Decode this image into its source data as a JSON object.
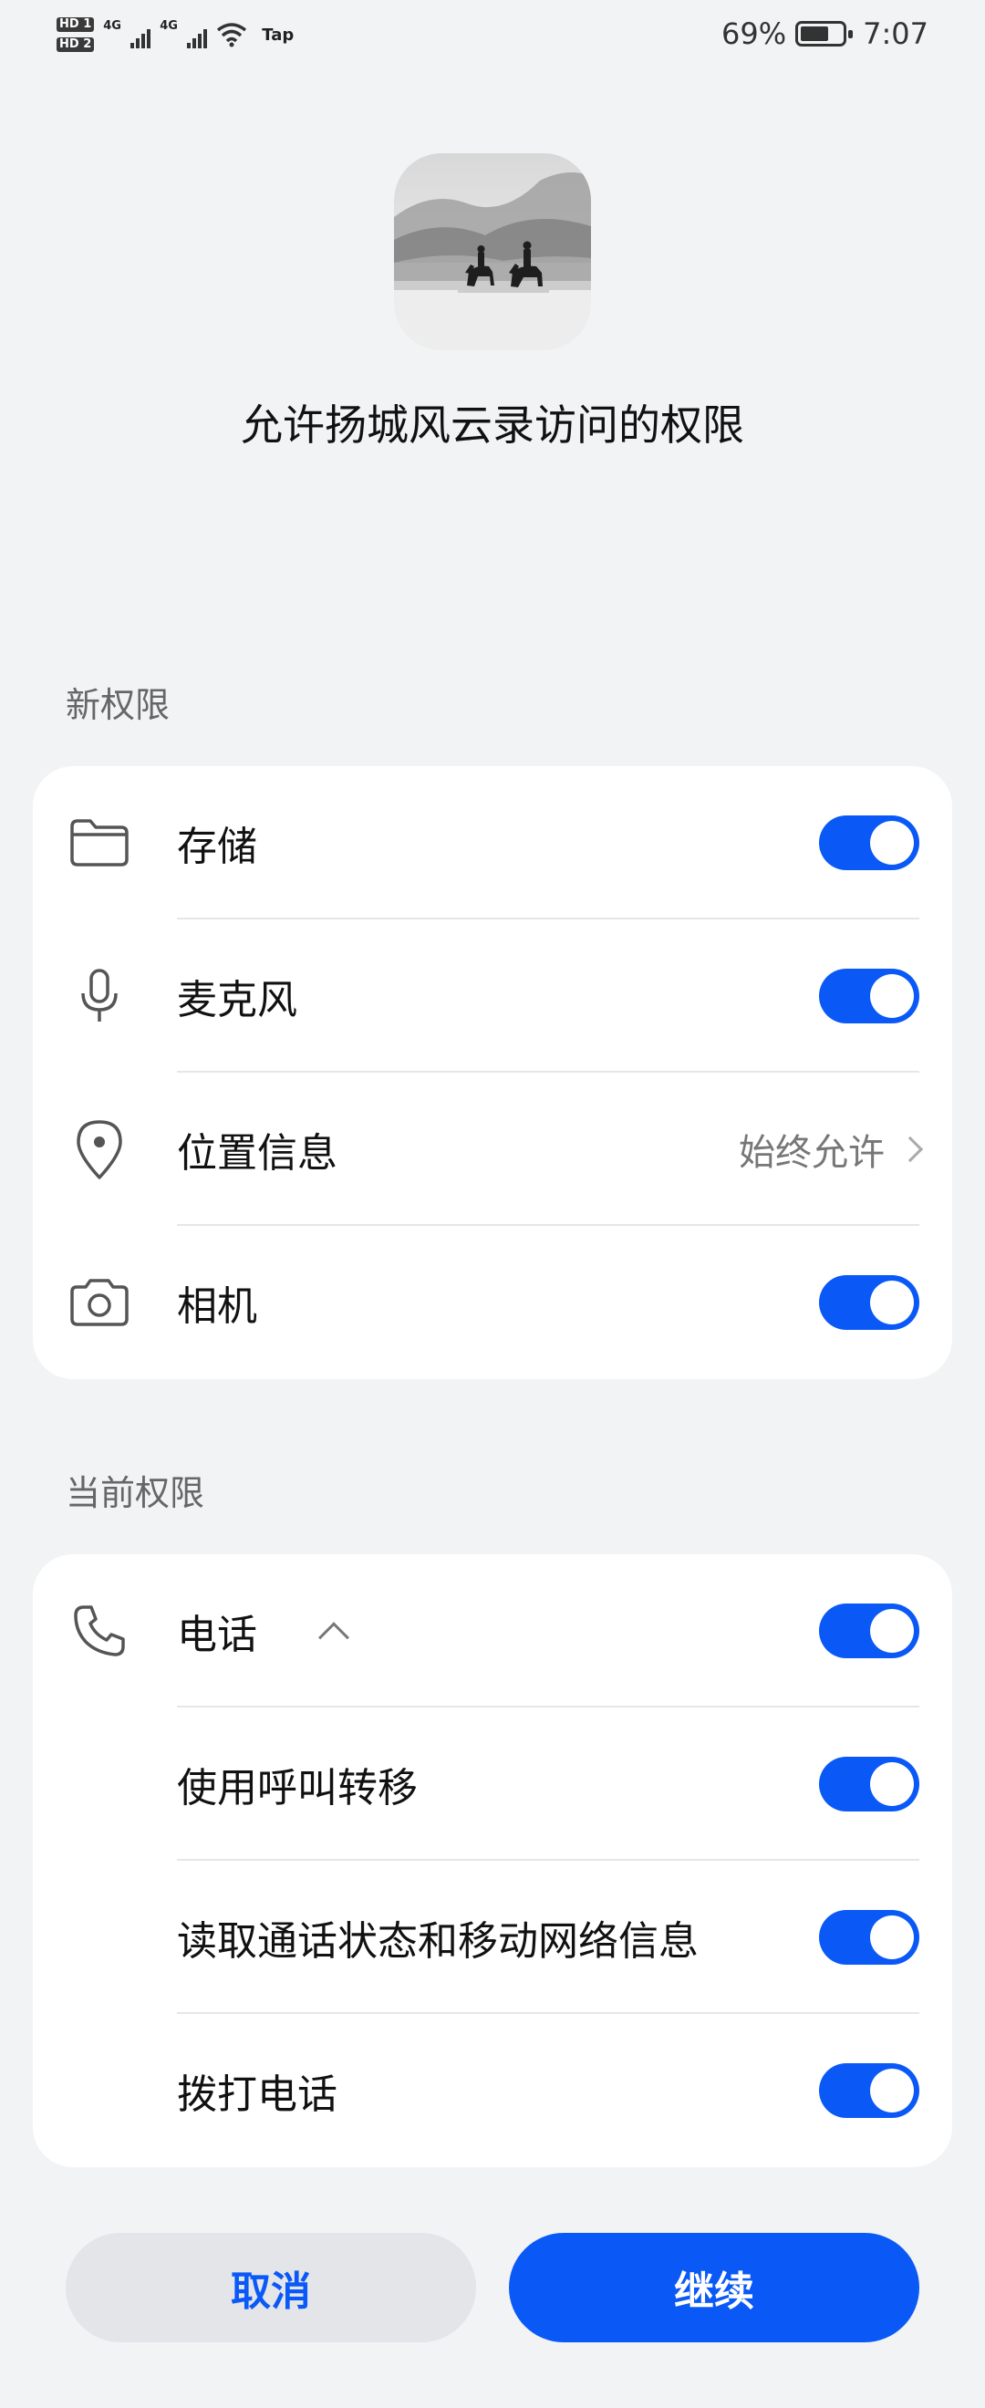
{
  "status_bar": {
    "sim1": "HD 1",
    "sim2": "HD 2",
    "net1": "4G",
    "net2": "4G",
    "extra": "Tap",
    "battery_percent": "69%",
    "battery_level": 0.69,
    "time": "7:07"
  },
  "app": {
    "icon": "ink-landscape-horsemen",
    "title": "允许扬城风云录访问的权限"
  },
  "new_permissions": {
    "label": "新权限",
    "items": [
      {
        "icon": "folder-icon",
        "label": "存储",
        "enabled": true
      },
      {
        "icon": "microphone-icon",
        "label": "麦克风",
        "enabled": true
      },
      {
        "icon": "location-pin-icon",
        "label": "位置信息",
        "value": "始终允许"
      },
      {
        "icon": "camera-icon",
        "label": "相机",
        "enabled": true
      }
    ]
  },
  "current_permissions": {
    "label": "当前权限",
    "group": {
      "icon": "phone-icon",
      "label": "电话",
      "expanded": true,
      "enabled": true
    },
    "items": [
      {
        "label": "使用呼叫转移",
        "enabled": true
      },
      {
        "label": "读取通话状态和移动网络信息",
        "enabled": true
      },
      {
        "label": "拨打电话",
        "enabled": true
      }
    ]
  },
  "buttons": {
    "cancel": "取消",
    "continue": "继续"
  },
  "colors": {
    "accent": "#0a59f7",
    "background": "#f1f3f5"
  }
}
